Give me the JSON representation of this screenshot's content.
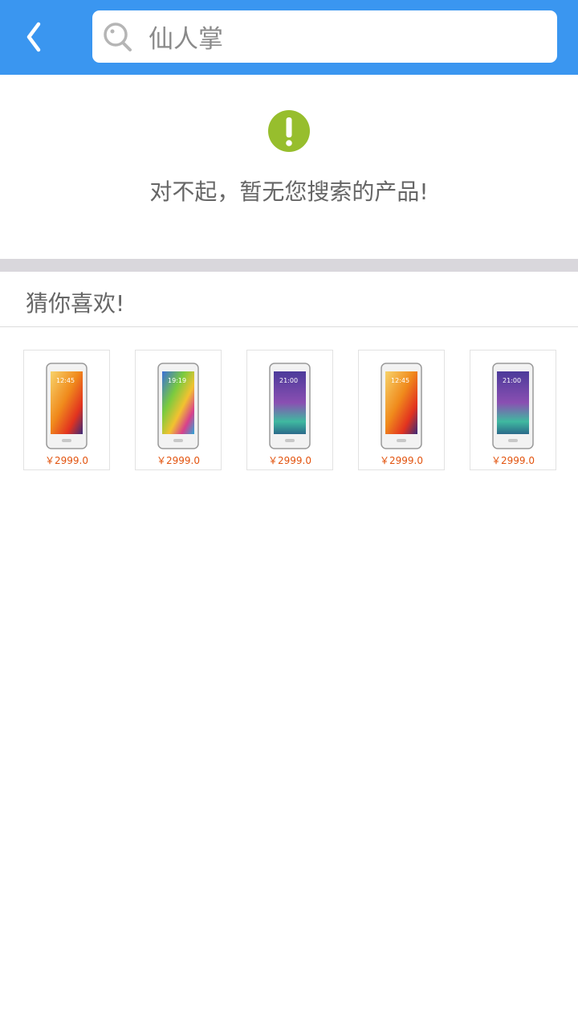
{
  "header": {
    "search": {
      "value": "仙人掌",
      "placeholder": ""
    }
  },
  "empty_state": {
    "message": "对不起，暂无您搜索的产品!",
    "icon": "exclamation-icon",
    "icon_color": "#97be2d"
  },
  "recommend": {
    "title": "猜你喜欢!",
    "products": [
      {
        "price": "￥2999.0",
        "clock": "12:45",
        "screen": "orange"
      },
      {
        "price": "￥2999.0",
        "clock": "19:19",
        "screen": "blue"
      },
      {
        "price": "￥2999.0",
        "clock": "21:00",
        "screen": "purple"
      },
      {
        "price": "￥2999.0",
        "clock": "12:45",
        "screen": "orange"
      },
      {
        "price": "￥2999.0",
        "clock": "21:00",
        "screen": "purple"
      }
    ]
  },
  "colors": {
    "header_bg": "#3a96f0",
    "price": "#e2530e",
    "divider": "#d9d7dc"
  }
}
